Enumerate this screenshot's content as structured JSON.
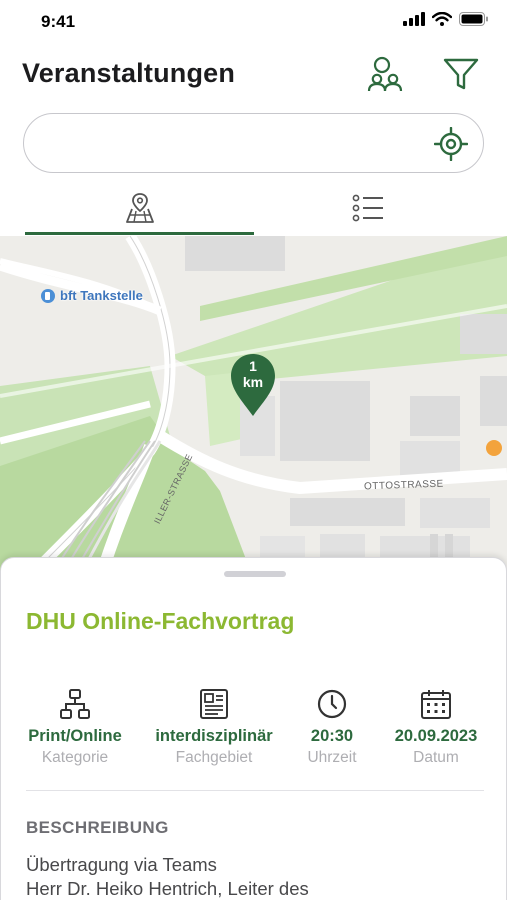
{
  "status_bar": {
    "time": "9:41"
  },
  "header": {
    "title": "Veranstaltungen",
    "people_icon": "people-icon",
    "filter_icon": "filter-icon"
  },
  "search": {
    "value": "",
    "placeholder": "",
    "locate_icon": "crosshair-icon"
  },
  "tabs": [
    {
      "name": "map",
      "icon": "map-pin-icon",
      "selected": true
    },
    {
      "name": "list",
      "icon": "list-icon",
      "selected": false
    }
  ],
  "map": {
    "poi_label": "bft Tankstelle",
    "street_label_1": "OTTOSTRASSE",
    "street_label_2": "ILLER-STRASSE",
    "cluster_line1": "1",
    "cluster_line2": "km"
  },
  "event": {
    "title": "DHU Online-Fachvortrag",
    "details": [
      {
        "icon": "hierarchy-icon",
        "value": "Print/Online",
        "label": "Kategorie"
      },
      {
        "icon": "document-icon",
        "value": "interdisziplinär",
        "label": "Fachgebiet"
      },
      {
        "icon": "clock-icon",
        "value": "20:30",
        "label": "Uhrzeit"
      },
      {
        "icon": "calendar-icon",
        "value": "20.09.2023",
        "label": "Datum"
      }
    ],
    "description_heading": "BESCHREIBUNG",
    "description_lines": [
      "Übertragung via Teams",
      "Herr Dr. Heiko Hentrich, Leiter des"
    ]
  },
  "colors": {
    "accent": "#2d6a3e",
    "title_green": "#8cb832",
    "park_green": "#c9e3b6",
    "map_bg": "#eeede9"
  }
}
